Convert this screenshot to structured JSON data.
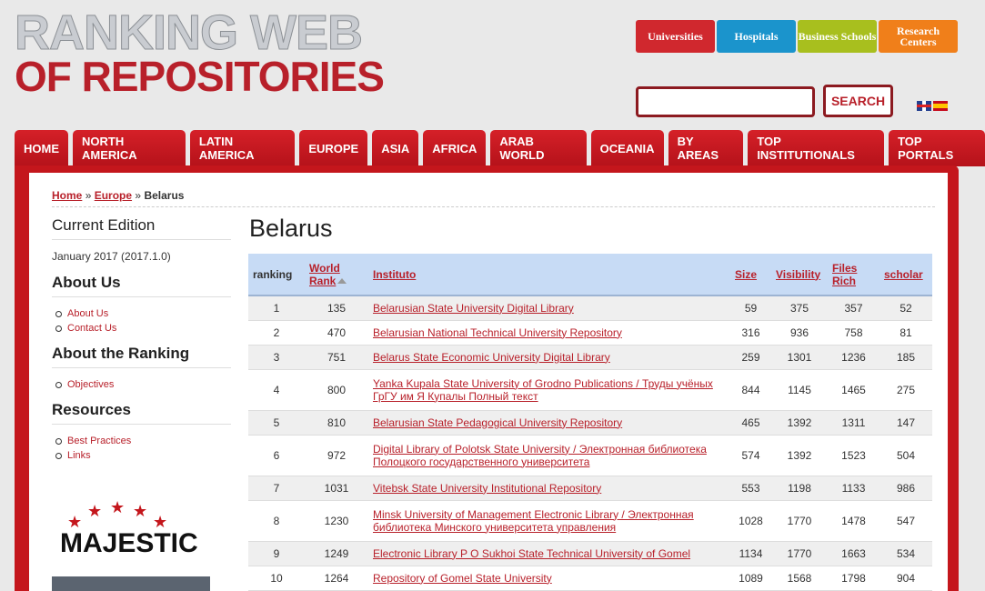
{
  "logo": {
    "line1": "RANKING WEB",
    "line2": "OF REPOSITORIES"
  },
  "top_tabs": [
    {
      "label": "Universities",
      "color": "#d0282e"
    },
    {
      "label": "Hospitals",
      "color": "#1b94cc"
    },
    {
      "label": "Business Schools",
      "color": "#a8bf1e"
    },
    {
      "label": "Research Centers",
      "color": "#f07f1a"
    }
  ],
  "search": {
    "placeholder": "",
    "button_label": "SEARCH"
  },
  "nav": [
    "HOME",
    "NORTH AMERICA",
    "LATIN AMERICA",
    "EUROPE",
    "ASIA",
    "AFRICA",
    "ARAB WORLD",
    "OCEANIA",
    "BY AREAS",
    "TOP INSTITUTIONALS",
    "TOP PORTALS"
  ],
  "breadcrumb": {
    "home": "Home",
    "sep1": "»",
    "europe": "Europe",
    "sep2": "»",
    "current": "Belarus"
  },
  "sidebar": {
    "current_edition_title": "Current Edition",
    "current_edition_value": "January 2017 (2017.1.0)",
    "about_us_title": "About Us",
    "about_us_links": [
      "About Us",
      "Contact Us"
    ],
    "about_ranking_title": "About the Ranking",
    "about_ranking_links": [
      "Objectives"
    ],
    "resources_title": "Resources",
    "resources_links": [
      "Best Practices",
      "Links"
    ],
    "majestic_label": "MAJESTIC"
  },
  "page_title": "Belarus",
  "table": {
    "headers": {
      "ranking": "ranking",
      "world_rank_1": "World",
      "world_rank_2": "Rank",
      "instituto": "Instituto",
      "size": "Size",
      "visibility": "Visibility",
      "files_1": "Files",
      "files_2": "Rich",
      "scholar": "scholar"
    },
    "rows": [
      {
        "ranking": "1",
        "world": "135",
        "inst": "Belarusian State University Digital Library",
        "size": "59",
        "vis": "375",
        "files": "357",
        "scholar": "52"
      },
      {
        "ranking": "2",
        "world": "470",
        "inst": "Belarusian National Technical University Repository",
        "size": "316",
        "vis": "936",
        "files": "758",
        "scholar": "81"
      },
      {
        "ranking": "3",
        "world": "751",
        "inst": "Belarus State Economic University Digital Library",
        "size": "259",
        "vis": "1301",
        "files": "1236",
        "scholar": "185"
      },
      {
        "ranking": "4",
        "world": "800",
        "inst": "Yanka Kupala State University of Grodno Publications / Труды учёных ГрГУ им Я Купалы Полный текст",
        "size": "844",
        "vis": "1145",
        "files": "1465",
        "scholar": "275"
      },
      {
        "ranking": "5",
        "world": "810",
        "inst": "Belarusian State Pedagogical University Repository",
        "size": "465",
        "vis": "1392",
        "files": "1311",
        "scholar": "147"
      },
      {
        "ranking": "6",
        "world": "972",
        "inst": "Digital Library of Polotsk State University / Электронная библиотека Полоцкого государственного университета",
        "size": "574",
        "vis": "1392",
        "files": "1523",
        "scholar": "504"
      },
      {
        "ranking": "7",
        "world": "1031",
        "inst": "Vitebsk State University Institutional Repository",
        "size": "553",
        "vis": "1198",
        "files": "1133",
        "scholar": "986"
      },
      {
        "ranking": "8",
        "world": "1230",
        "inst": "Minsk University of Management Electronic Library / Электронная библиотека Минского университета управления",
        "size": "1028",
        "vis": "1770",
        "files": "1478",
        "scholar": "547"
      },
      {
        "ranking": "9",
        "world": "1249",
        "inst": "Electronic Library P O Sukhoi State Technical University of Gomel",
        "size": "1134",
        "vis": "1770",
        "files": "1663",
        "scholar": "534"
      },
      {
        "ranking": "10",
        "world": "1264",
        "inst": "Repository of Gomel State University",
        "size": "1089",
        "vis": "1568",
        "files": "1798",
        "scholar": "904"
      }
    ]
  }
}
